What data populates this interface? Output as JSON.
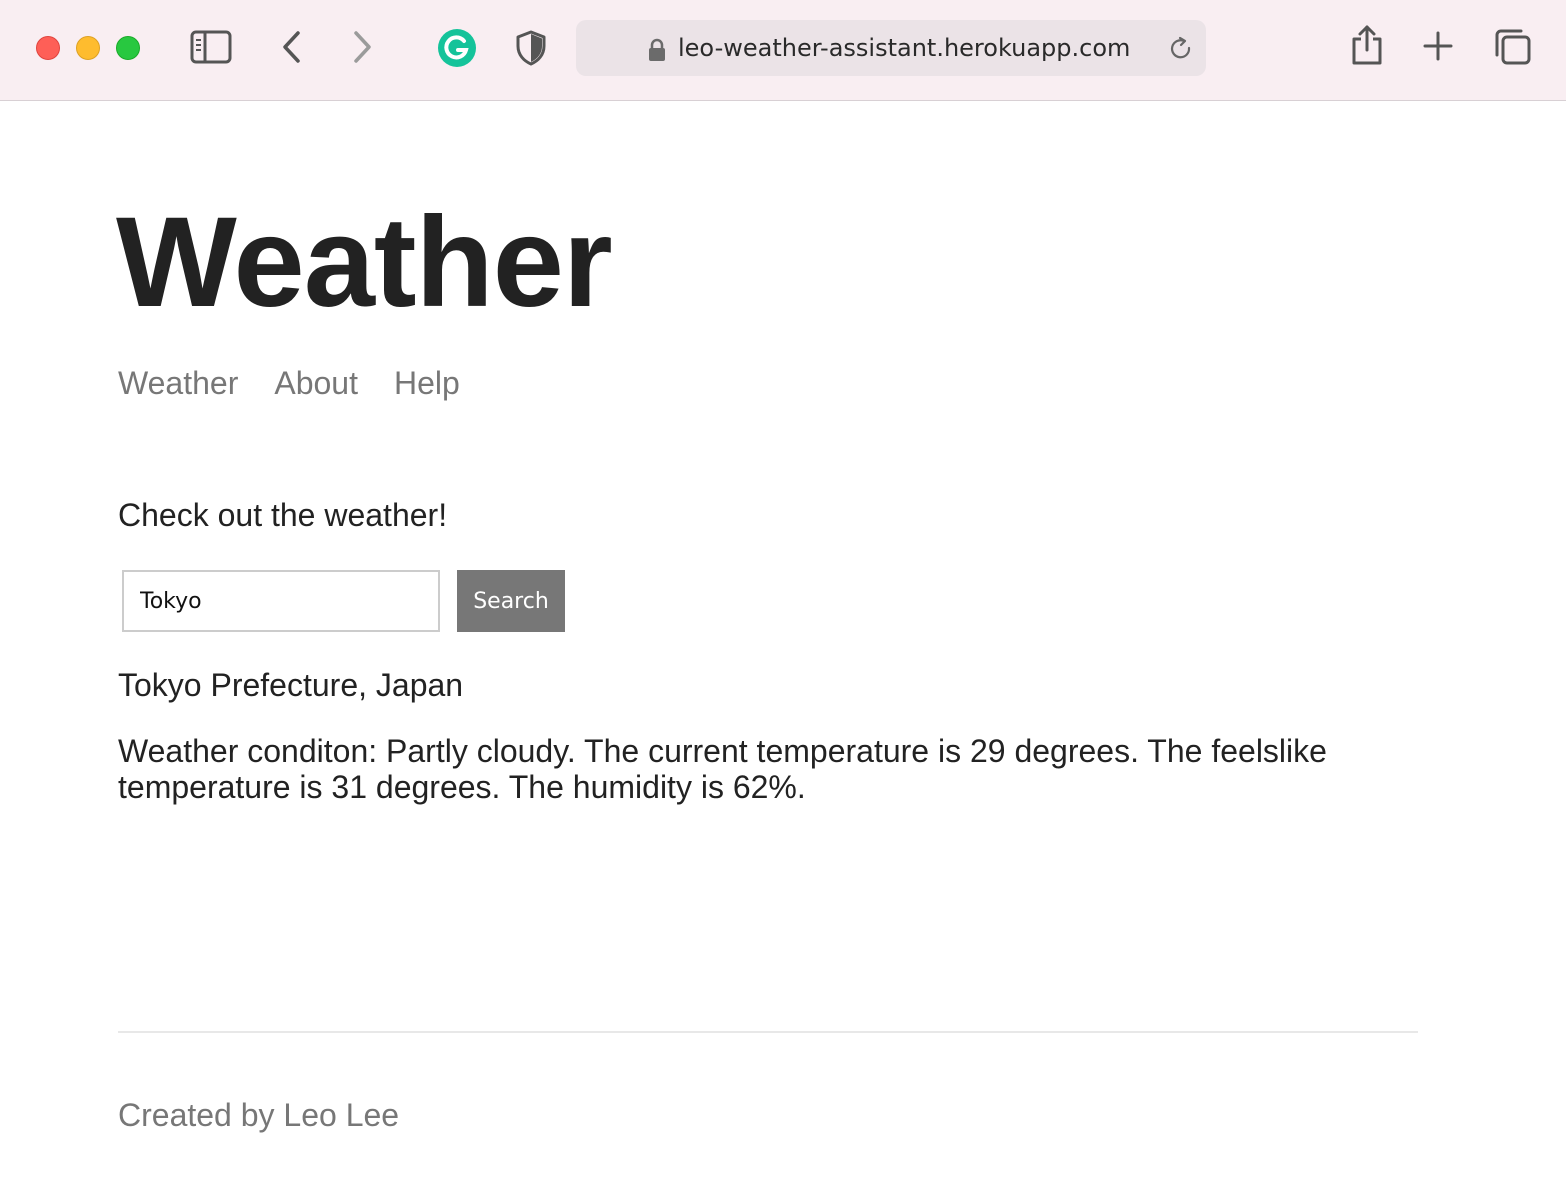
{
  "browser": {
    "url": "leo-weather-assistant.herokuapp.com",
    "icons": {
      "sidebar": "sidebar-icon",
      "back": "chevron-left-icon",
      "forward": "chevron-right-icon",
      "extension_grammarly": "grammarly-icon",
      "extension_privacy": "shield-icon",
      "lock": "lock-icon",
      "reload": "reload-icon",
      "share": "share-icon",
      "new_tab": "plus-icon",
      "tabs_overview": "tabs-icon"
    },
    "colors": {
      "toolbar_bg": "#f9eef2",
      "address_bg": "#ebe3e7",
      "close": "#fe5f57",
      "minimize": "#febc2e",
      "zoom": "#28c840",
      "grammarly": "#15c39a"
    }
  },
  "site": {
    "title": "Weather",
    "nav": [
      {
        "label": "Weather"
      },
      {
        "label": "About"
      },
      {
        "label": "Help"
      }
    ]
  },
  "main": {
    "intro": "Check out the weather!",
    "search": {
      "value": "Tokyo",
      "button_label": "Search"
    },
    "location": "Tokyo Prefecture, Japan",
    "forecast": "Weather conditon: Partly cloudy. The current temperature is 29 degrees. The feelslike temperature is 31 degrees. The humidity is 62%."
  },
  "footer": {
    "text": "Created by Leo Lee"
  },
  "colors": {
    "text": "#222222",
    "muted": "#777777",
    "button_bg": "#777777",
    "divider": "#e8e8e8"
  }
}
